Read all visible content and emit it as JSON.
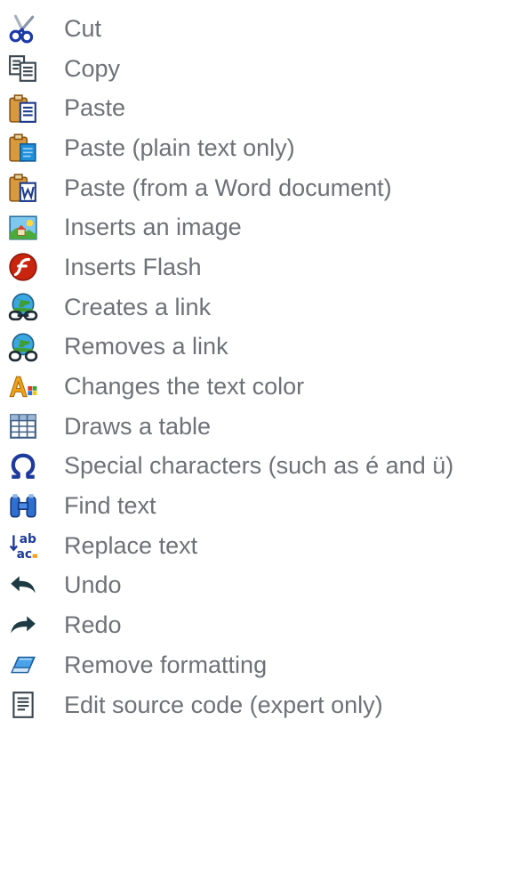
{
  "toolbar_help": {
    "items": [
      {
        "icon": "cut-icon",
        "label": "Cut"
      },
      {
        "icon": "copy-icon",
        "label": "Copy"
      },
      {
        "icon": "paste-icon",
        "label": "Paste"
      },
      {
        "icon": "paste-plain-text-icon",
        "label": "Paste (plain text only)"
      },
      {
        "icon": "paste-word-icon",
        "label": "Paste (from a Word document)"
      },
      {
        "icon": "image-icon",
        "label": "Inserts an image"
      },
      {
        "icon": "flash-icon",
        "label": "Inserts Flash"
      },
      {
        "icon": "link-icon",
        "label": "Creates a link"
      },
      {
        "icon": "unlink-icon",
        "label": "Removes a link"
      },
      {
        "icon": "text-color-icon",
        "label": "Changes the text color"
      },
      {
        "icon": "table-icon",
        "label": "Draws a table"
      },
      {
        "icon": "omega-icon",
        "label": "Special characters (such as é and ü)"
      },
      {
        "icon": "binoculars-icon",
        "label": "Find text"
      },
      {
        "icon": "replace-icon",
        "label": "Replace text"
      },
      {
        "icon": "undo-icon",
        "label": "Undo"
      },
      {
        "icon": "redo-icon",
        "label": "Redo"
      },
      {
        "icon": "eraser-icon",
        "label": "Remove formatting"
      },
      {
        "icon": "source-icon",
        "label": "Edit source code (expert only)"
      }
    ]
  }
}
